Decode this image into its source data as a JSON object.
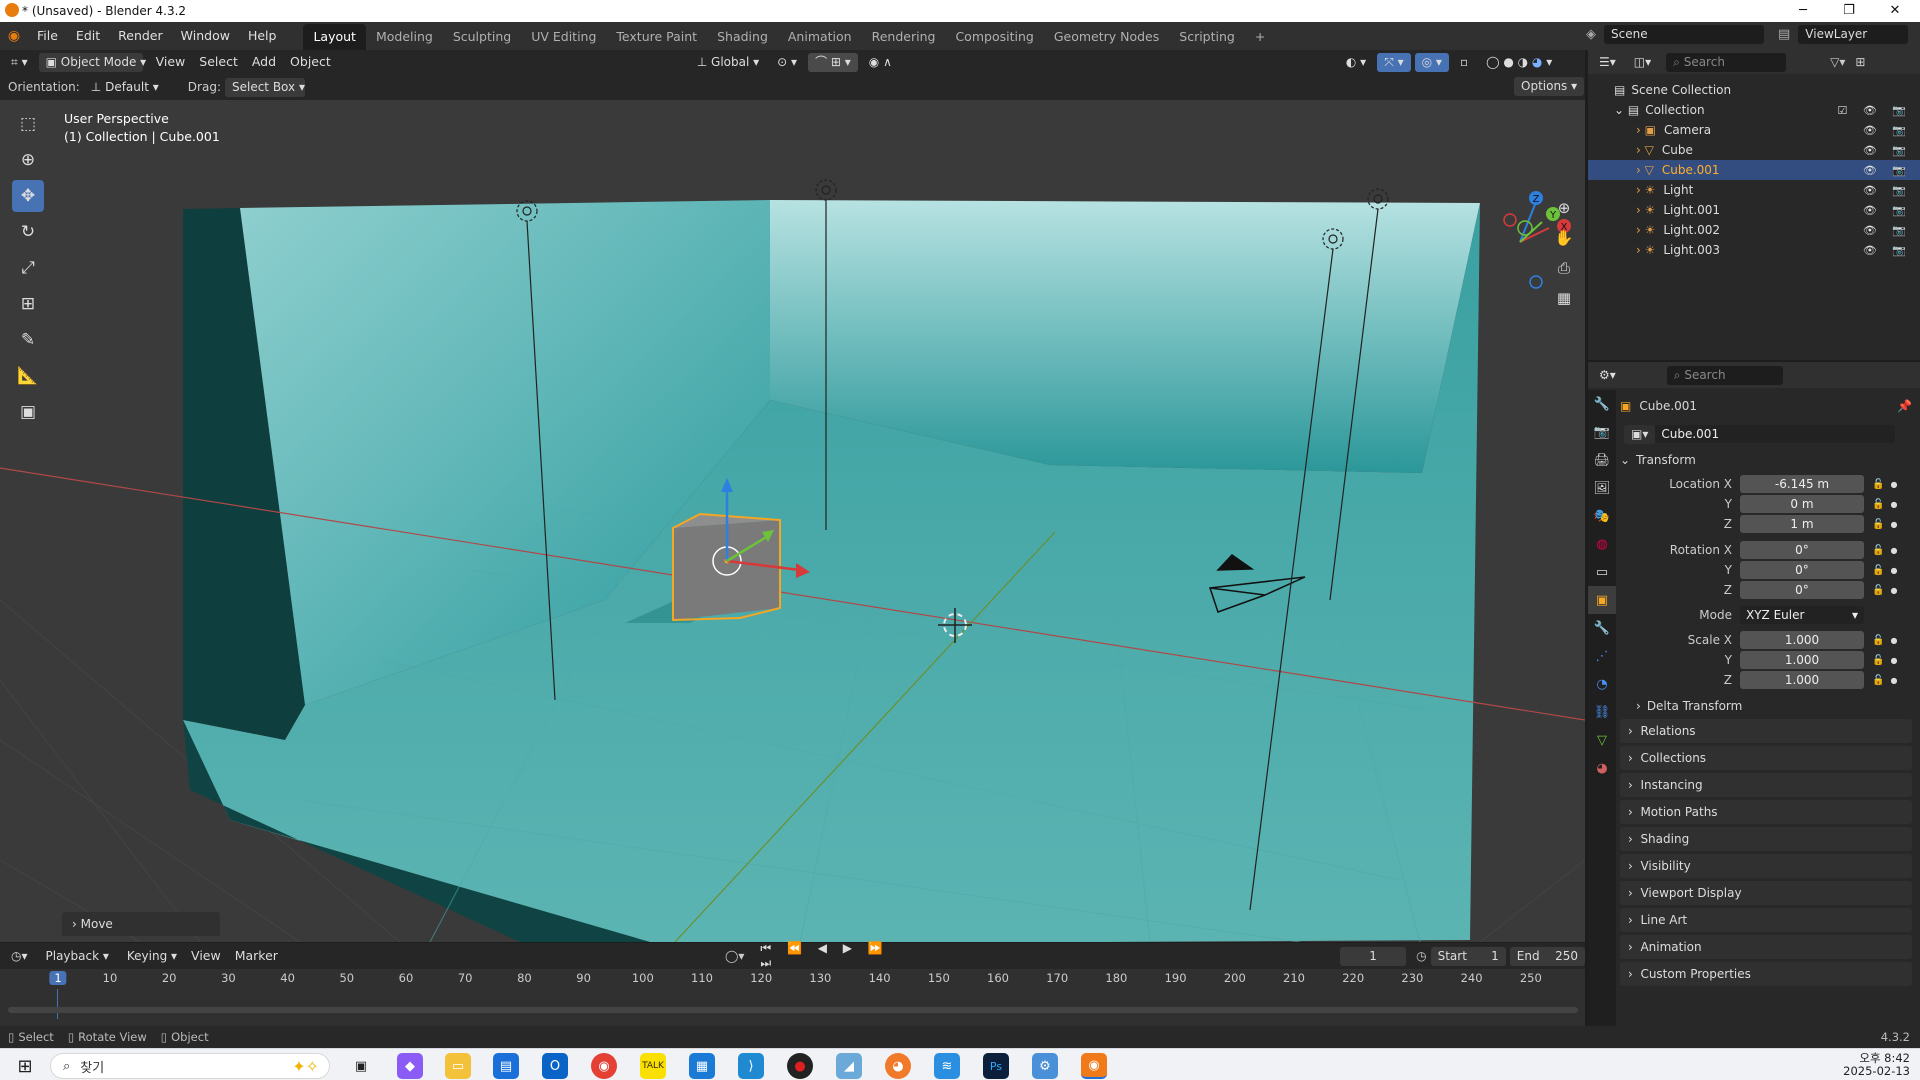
{
  "window": {
    "title": "* (Unsaved) - Blender 4.3.2",
    "minimize": "─",
    "maximize": "❐",
    "close": "✕"
  },
  "menubar": {
    "items": [
      "File",
      "Edit",
      "Render",
      "Window",
      "Help"
    ]
  },
  "workspaces": [
    "Layout",
    "Modeling",
    "Sculpting",
    "UV Editing",
    "Texture Paint",
    "Shading",
    "Animation",
    "Rendering",
    "Compositing",
    "Geometry Nodes",
    "Scripting"
  ],
  "workspace_add": "+",
  "scene": {
    "name": "Scene",
    "view_layer": "ViewLayer"
  },
  "viewport_header": {
    "mode": "Object Mode",
    "menus": [
      "View",
      "Select",
      "Add",
      "Object"
    ],
    "transform_space": "Global"
  },
  "tool_settings": {
    "orientation_label": "Orientation:",
    "orientation_value": "Default",
    "drag_label": "Drag:",
    "drag_value": "Select Box",
    "options": "Options"
  },
  "viewport": {
    "perspective": "User Perspective",
    "context": "(1) Collection | Cube.001",
    "last_op": "Move"
  },
  "gizmo_axes": {
    "x": "X",
    "y": "Y",
    "z": "Z"
  },
  "outliner": {
    "search_placeholder": "Search",
    "root": "Scene Collection",
    "collection": "Collection",
    "items": [
      {
        "name": "Camera",
        "icon": "camera-icon",
        "selected": false
      },
      {
        "name": "Cube",
        "icon": "mesh-icon",
        "selected": false
      },
      {
        "name": "Cube.001",
        "icon": "mesh-icon",
        "selected": true
      },
      {
        "name": "Light",
        "icon": "light-icon",
        "selected": false
      },
      {
        "name": "Light.001",
        "icon": "light-icon",
        "selected": false
      },
      {
        "name": "Light.002",
        "icon": "light-icon",
        "selected": false
      },
      {
        "name": "Light.003",
        "icon": "light-icon",
        "selected": false
      }
    ]
  },
  "properties": {
    "search_placeholder": "Search",
    "object_name": "Cube.001",
    "datablock_name": "Cube.001",
    "transform_label": "Transform",
    "location": {
      "label_x": "Location X",
      "x": "-6.145 m",
      "y": "0 m",
      "z": "1 m"
    },
    "rotation": {
      "label_x": "Rotation X",
      "x": "0°",
      "y": "0°",
      "z": "0°"
    },
    "mode_label": "Mode",
    "mode_value": "XYZ Euler",
    "scale": {
      "label_x": "Scale X",
      "x": "1.000",
      "y": "1.000",
      "z": "1.000"
    },
    "axis_y": "Y",
    "axis_z": "Z",
    "delta_transform": "Delta Transform",
    "panels": [
      "Relations",
      "Collections",
      "Instancing",
      "Motion Paths",
      "Shading",
      "Visibility",
      "Viewport Display",
      "Line Art",
      "Animation",
      "Custom Properties"
    ],
    "version": "4.3.2"
  },
  "timeline": {
    "menus": [
      "Playback",
      "Keying",
      "View",
      "Marker"
    ],
    "current_frame": "1",
    "start_label": "Start",
    "start": "1",
    "end_label": "End",
    "end": "250",
    "ruler": [
      "10",
      "20",
      "30",
      "40",
      "50",
      "60",
      "70",
      "80",
      "90",
      "100",
      "110",
      "120",
      "130",
      "140",
      "150",
      "160",
      "170",
      "180",
      "190",
      "200",
      "210",
      "220",
      "230",
      "240",
      "250"
    ],
    "playhead": "1"
  },
  "statusbar": {
    "select": "Select",
    "rotate": "Rotate View",
    "object": "Object"
  },
  "taskbar": {
    "search": "찾기",
    "time": "오후 8:42",
    "date": "2025-02-13"
  }
}
